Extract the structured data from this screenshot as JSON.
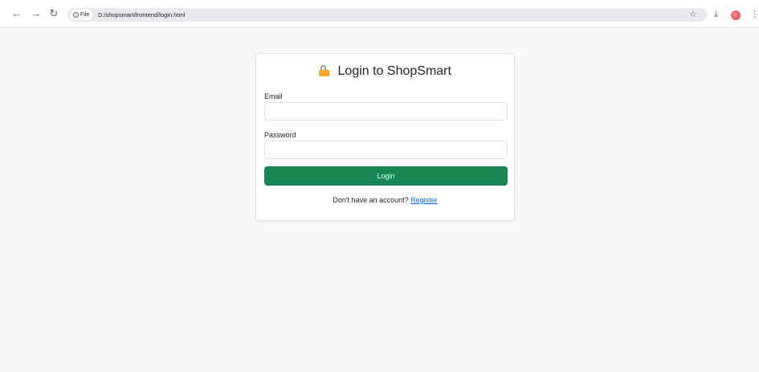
{
  "browser": {
    "site_chip_label": "File",
    "url": "D:/shopsmart/frontend/login.html",
    "icons": {
      "back": "arrow-left-icon",
      "forward": "arrow-right-icon",
      "reload": "reload-icon",
      "info": "info-icon",
      "bookmark": "star-icon",
      "download": "download-icon",
      "profile": "avatar",
      "menu": "kebab-menu-icon"
    }
  },
  "login": {
    "title": "Login to ShopSmart",
    "title_icon": "lock-icon",
    "email_label": "Email",
    "email_value": "",
    "password_label": "Password",
    "password_value": "",
    "submit_label": "Login",
    "register_prompt": "Don't have an account?",
    "register_link": "Register"
  },
  "colors": {
    "page_background": "#f8f9fa",
    "primary_button": "#198754",
    "link": "#0d6efd"
  }
}
